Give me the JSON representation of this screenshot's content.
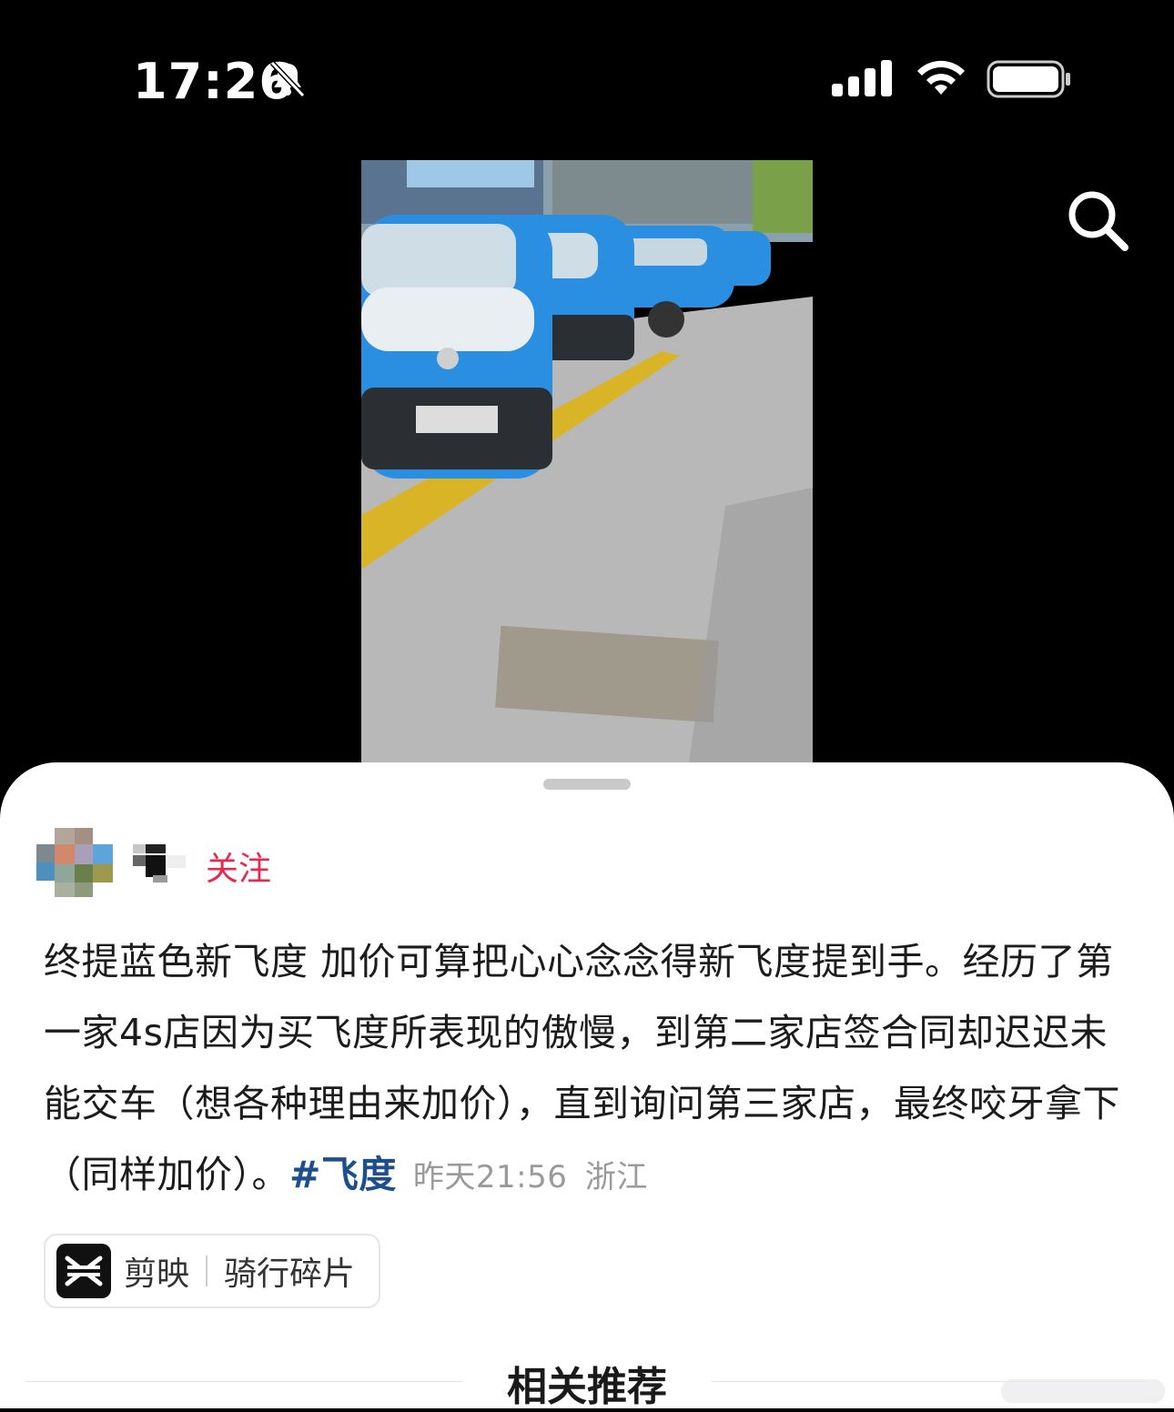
{
  "status_bar": {
    "time": "17:26",
    "icons": [
      "bell-muted-icon",
      "signal-icon",
      "wifi-icon",
      "battery-icon"
    ]
  },
  "toolbar": {
    "search_icon": "search-icon"
  },
  "post": {
    "author": {
      "follow_label": "关注"
    },
    "description": "终提蓝色新飞度 加价可算把心心念念得新飞度提到手。经历了第一家4s店因为买飞度所表现的傲慢，到第二家店签合同却迟迟未能交车（想各种理由来加价），直到询问第三家店，最终咬牙拿下（同样加价）。",
    "hashtag": "#飞度",
    "time": "昨天21:56",
    "location": "浙江"
  },
  "capcut_tag": {
    "app_name": "剪映",
    "template_name": "骑行碎片"
  },
  "recommend": {
    "title": "相关推荐"
  },
  "colors": {
    "follow": "#e8294d",
    "hashtag": "#1c4f8c",
    "car_blue": "#2a8fe0",
    "background": "#000000"
  }
}
